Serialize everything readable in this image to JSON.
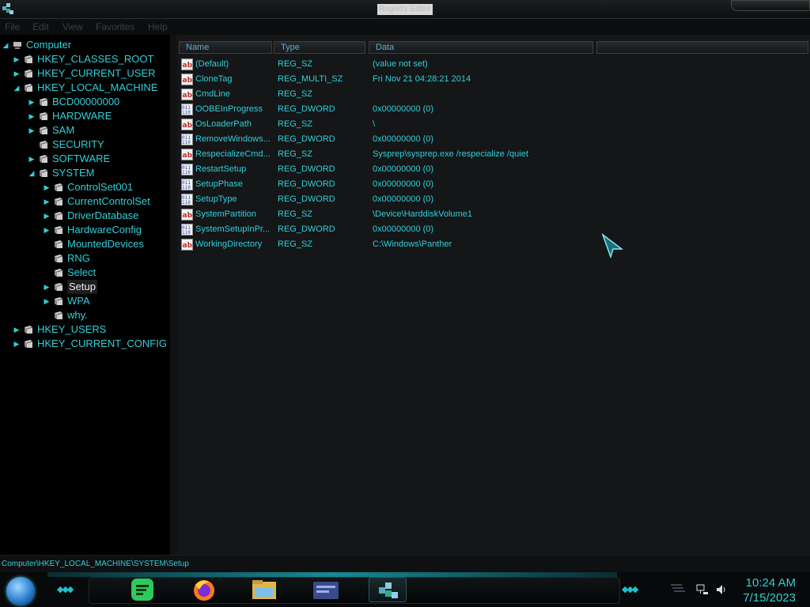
{
  "window": {
    "title": "Registry Editor"
  },
  "menu": [
    "File",
    "Edit",
    "View",
    "Favorites",
    "Help"
  ],
  "tree": [
    {
      "label": "Computer",
      "depth": 0,
      "expander": "open"
    },
    {
      "label": "HKEY_CLASSES_ROOT",
      "depth": 1,
      "expander": "closed"
    },
    {
      "label": "HKEY_CURRENT_USER",
      "depth": 1,
      "expander": "closed"
    },
    {
      "label": "HKEY_LOCAL_MACHINE",
      "depth": 1,
      "expander": "open"
    },
    {
      "label": "BCD00000000",
      "depth": 2,
      "expander": "closed"
    },
    {
      "label": "HARDWARE",
      "depth": 2,
      "expander": "closed"
    },
    {
      "label": "SAM",
      "depth": 2,
      "expander": "closed"
    },
    {
      "label": "SECURITY",
      "depth": 2,
      "expander": "none"
    },
    {
      "label": "SOFTWARE",
      "depth": 2,
      "expander": "closed"
    },
    {
      "label": "SYSTEM",
      "depth": 2,
      "expander": "open"
    },
    {
      "label": "ControlSet001",
      "depth": 3,
      "expander": "closed"
    },
    {
      "label": "CurrentControlSet",
      "depth": 3,
      "expander": "closed"
    },
    {
      "label": "DriverDatabase",
      "depth": 3,
      "expander": "closed"
    },
    {
      "label": "HardwareConfig",
      "depth": 3,
      "expander": "closed"
    },
    {
      "label": "MountedDevices",
      "depth": 3,
      "expander": "none"
    },
    {
      "label": "RNG",
      "depth": 3,
      "expander": "none"
    },
    {
      "label": "Select",
      "depth": 3,
      "expander": "none"
    },
    {
      "label": "Setup",
      "depth": 3,
      "expander": "closed",
      "selected": true
    },
    {
      "label": "WPA",
      "depth": 3,
      "expander": "closed"
    },
    {
      "label": "why.",
      "depth": 3,
      "expander": "none"
    },
    {
      "label": "HKEY_USERS",
      "depth": 1,
      "expander": "closed"
    },
    {
      "label": "HKEY_CURRENT_CONFIG",
      "depth": 1,
      "expander": "closed"
    }
  ],
  "list": {
    "columns": [
      "Name",
      "Type",
      "Data"
    ],
    "rows": [
      {
        "name": "(Default)",
        "type": "REG_SZ",
        "data": "(value not set)",
        "icon": "string-value-icon"
      },
      {
        "name": "CloneTag",
        "type": "REG_MULTI_SZ",
        "data": "Fri Nov 21 04:28:21 2014",
        "icon": "string-value-icon"
      },
      {
        "name": "CmdLine",
        "type": "REG_SZ",
        "data": "",
        "icon": "string-value-icon"
      },
      {
        "name": "OOBEInProgress",
        "type": "REG_DWORD",
        "data": "0x00000000 (0)",
        "icon": "binary-value-icon"
      },
      {
        "name": "OsLoaderPath",
        "type": "REG_SZ",
        "data": "\\",
        "icon": "string-value-icon"
      },
      {
        "name": "RemoveWindows...",
        "type": "REG_DWORD",
        "data": "0x00000000 (0)",
        "icon": "binary-value-icon"
      },
      {
        "name": "RespecializeCmd...",
        "type": "REG_SZ",
        "data": "Sysprep\\sysprep.exe /respecialize /quiet",
        "icon": "string-value-icon"
      },
      {
        "name": "RestartSetup",
        "type": "REG_DWORD",
        "data": "0x00000000 (0)",
        "icon": "binary-value-icon"
      },
      {
        "name": "SetupPhase",
        "type": "REG_DWORD",
        "data": "0x00000000 (0)",
        "icon": "binary-value-icon"
      },
      {
        "name": "SetupType",
        "type": "REG_DWORD",
        "data": "0x00000000 (0)",
        "icon": "binary-value-icon"
      },
      {
        "name": "SystemPartition",
        "type": "REG_SZ",
        "data": "\\Device\\HarddiskVolume1",
        "icon": "string-value-icon"
      },
      {
        "name": "SystemSetupInPr...",
        "type": "REG_DWORD",
        "data": "0x00000000 (0)",
        "icon": "binary-value-icon"
      },
      {
        "name": "WorkingDirectory",
        "type": "REG_SZ",
        "data": "C:\\Windows\\Panther",
        "icon": "string-value-icon"
      }
    ]
  },
  "status": {
    "path": "Computer\\HKEY_LOCAL_MACHINE\\SYSTEM\\Setup"
  },
  "taskbar": {
    "apps": [
      {
        "name": "spotify-icon"
      },
      {
        "name": "firefox-icon"
      },
      {
        "name": "file-explorer-icon"
      },
      {
        "name": "control-panel-icon"
      },
      {
        "name": "registry-editor-icon",
        "active": true
      }
    ],
    "clock": {
      "time": "10:24 AM",
      "date": "7/15/2023"
    }
  },
  "colors": {
    "accent": "#2fd0d8",
    "background": "#141618"
  }
}
